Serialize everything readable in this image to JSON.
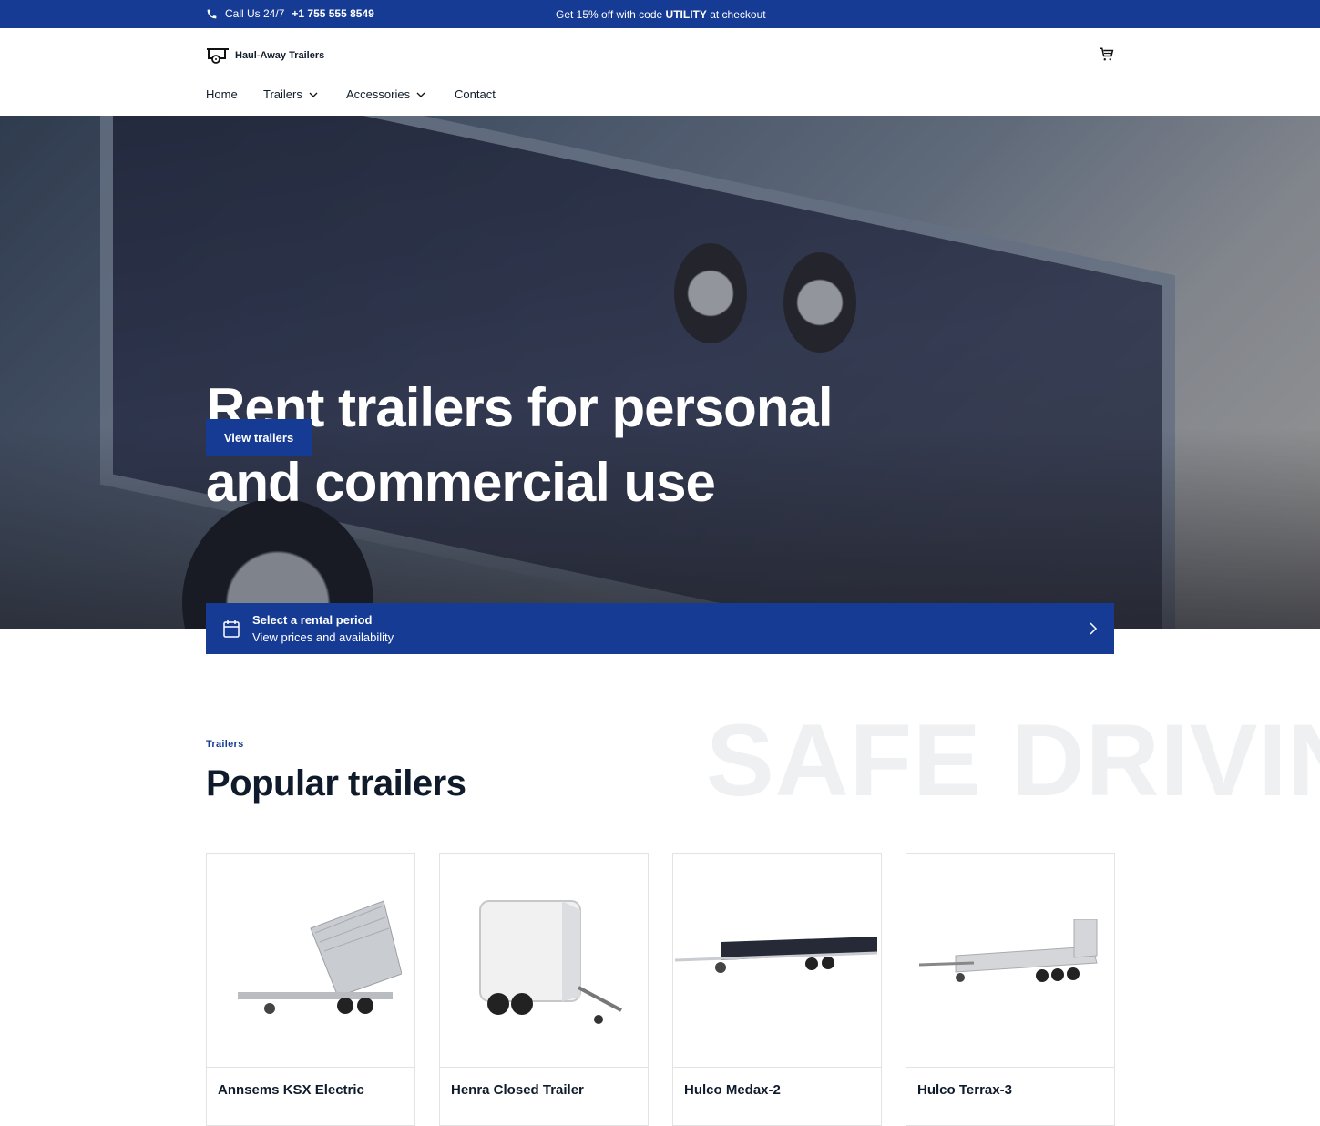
{
  "topbar": {
    "phone_label": "Call Us 24/7",
    "phone_number": "+1 755 555 8549",
    "promo_prefix": "Get 15% off with code",
    "promo_code": "UTILITY",
    "promo_suffix": "at checkout"
  },
  "header": {
    "brand": "Haul-Away Trailers",
    "cart_icon": "cart-icon"
  },
  "nav": {
    "items": [
      {
        "label": "Home",
        "has_dropdown": false
      },
      {
        "label": "Trailers",
        "has_dropdown": true
      },
      {
        "label": "Accessories",
        "has_dropdown": true
      },
      {
        "label": "Contact",
        "has_dropdown": false
      }
    ]
  },
  "hero": {
    "title": "Rent trailers for personal and commercial use",
    "cta_label": "View trailers"
  },
  "rental": {
    "title": "Select a rental period",
    "subtitle": "View prices and availability",
    "icon": "calendar-icon"
  },
  "popular": {
    "watermark": "SAFE DRIVING",
    "eyebrow": "Trailers",
    "title": "Popular trailers",
    "products": [
      {
        "name": "Annsems KSX Electric",
        "type": "tipper"
      },
      {
        "name": "Henra Closed Trailer",
        "type": "closed"
      },
      {
        "name": "Hulco Medax-2",
        "type": "flatbed"
      },
      {
        "name": "Hulco Terrax-3",
        "type": "machine"
      }
    ]
  },
  "colors": {
    "brand": "#163b94",
    "text": "#0f1b2a"
  }
}
